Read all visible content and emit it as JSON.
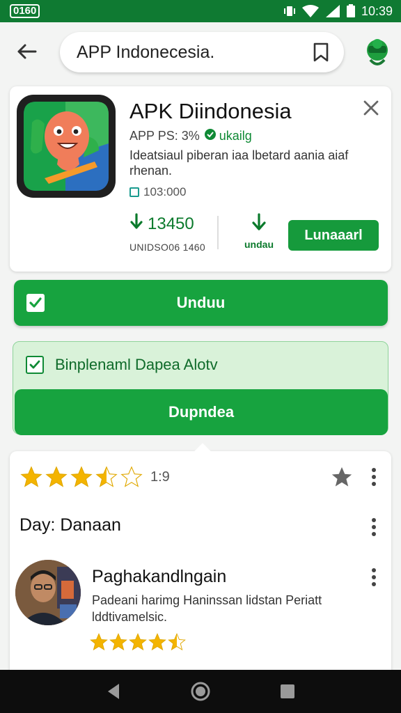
{
  "status_bar": {
    "carrier": "0160",
    "time": "10:39"
  },
  "top_bar": {
    "search_text": "APP Indonecesia."
  },
  "app_card": {
    "title": "APK Diindonesia",
    "meta": "APP PS: 3%",
    "meta_badge": "ukailg",
    "description": "Ideatsiaul piberan iaa lbetard aania  aiaf rhenan.",
    "size": "103:000",
    "downloads": "13450",
    "downloads_label": "UNIDSO06 1460",
    "mini_download_label": "undau",
    "install_label": "Lunaaarl"
  },
  "download_button": {
    "label": "Unduu"
  },
  "notice": {
    "text": "Binplenaml Dapea Alotv",
    "button_label": "Dupndea"
  },
  "review_card": {
    "rating": 3.5,
    "rating_text": "1:9",
    "section_title": "Day: Danaan",
    "reviewer": {
      "name": "Paghakandlngain",
      "text": "Padeani harimg Haninssan lidstan Periatt lddtivamelsic.",
      "rating": 4.5
    }
  },
  "colors": {
    "primary_green": "#17a33f",
    "status_green": "#0f7a32",
    "star_gold": "#f4b400",
    "notice_bg": "#d9f2d9"
  },
  "icons": [
    "wifi-icon",
    "signal-icon",
    "battery-icon",
    "vibrate-icon",
    "back-arrow-icon",
    "bookmark-icon",
    "close-icon",
    "download-icon",
    "check-icon",
    "star-icon",
    "more-vert-icon",
    "nav-back-icon",
    "nav-home-icon",
    "nav-recents-icon"
  ]
}
